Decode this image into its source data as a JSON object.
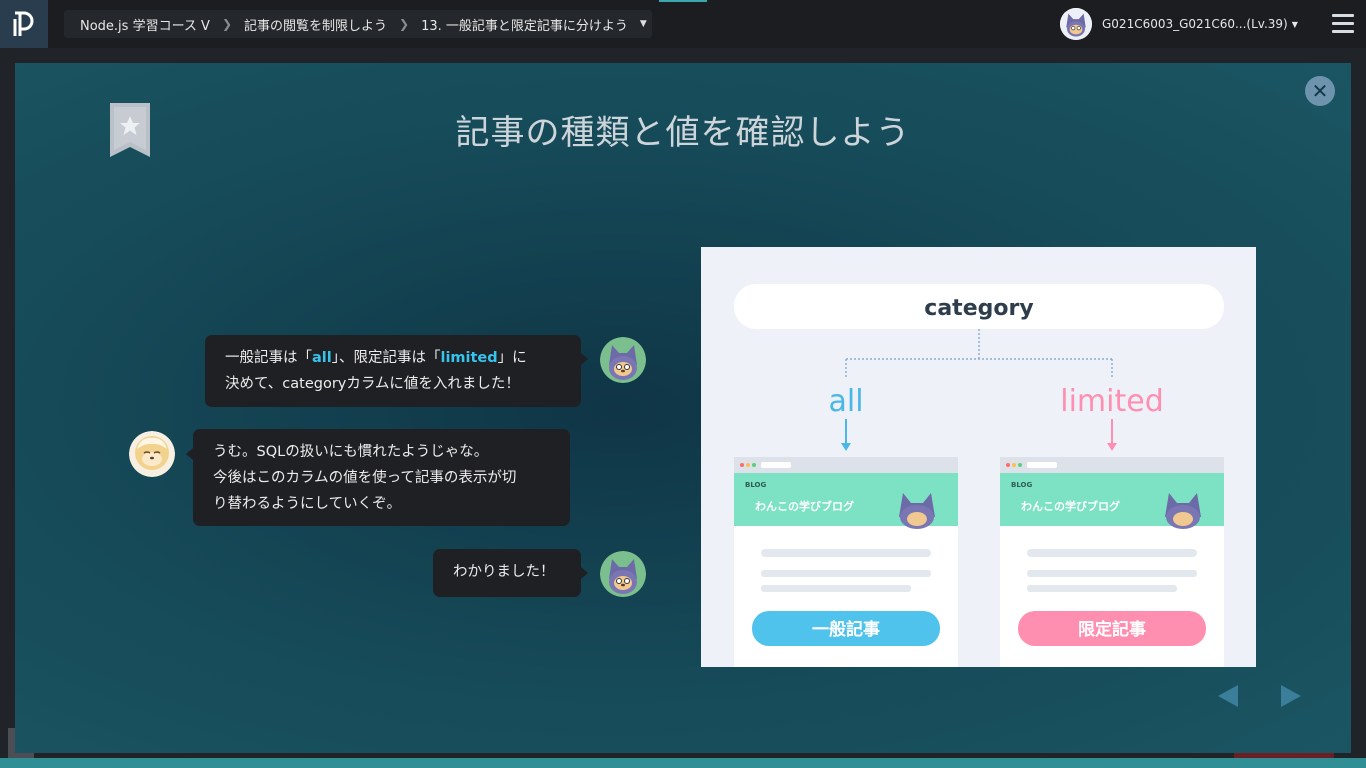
{
  "header": {
    "breadcrumbs": [
      "Node.js 学習コース V",
      "記事の閲覧を制限しよう",
      "13. 一般記事と限定記事に分けよう"
    ],
    "user_label": "G021C6003_G021C60...(Lv.39)"
  },
  "slide": {
    "title": "記事の種類と値を確認しよう",
    "messages": [
      {
        "line1_a": "一般記事は「",
        "line1_b": "all",
        "line1_c": "」、限定記事は「",
        "line1_d": "limited",
        "line1_e": "」に",
        "line2": "決めて、categoryカラムに値を入れました！"
      },
      {
        "line1": "うむ。SQLの扱いにも慣れたようじゃな。",
        "line2": "今後はこのカラムの値を使って記事の表示が切",
        "line3": "り替わるようにしていくぞ。"
      },
      {
        "line1": "わかりました！"
      }
    ]
  },
  "diagram": {
    "root_label": "category",
    "left_label": "all",
    "right_label": "limited",
    "card_header_small": "BLOG",
    "card_title": "わんこの学びブログ",
    "left_button": "一般記事",
    "right_button": "限定記事"
  },
  "colors": {
    "accent_blue": "#36c3ee",
    "accent_pink": "#ff8fb1",
    "card_green": "#7de2c3",
    "modal_bg": "#164a58"
  },
  "icons": [
    "app-logo-icon",
    "chevron-right-icon",
    "caret-down-icon",
    "hamburger-menu-icon",
    "bookmark-star-icon",
    "close-icon",
    "prev-arrow-icon",
    "next-arrow-icon"
  ]
}
